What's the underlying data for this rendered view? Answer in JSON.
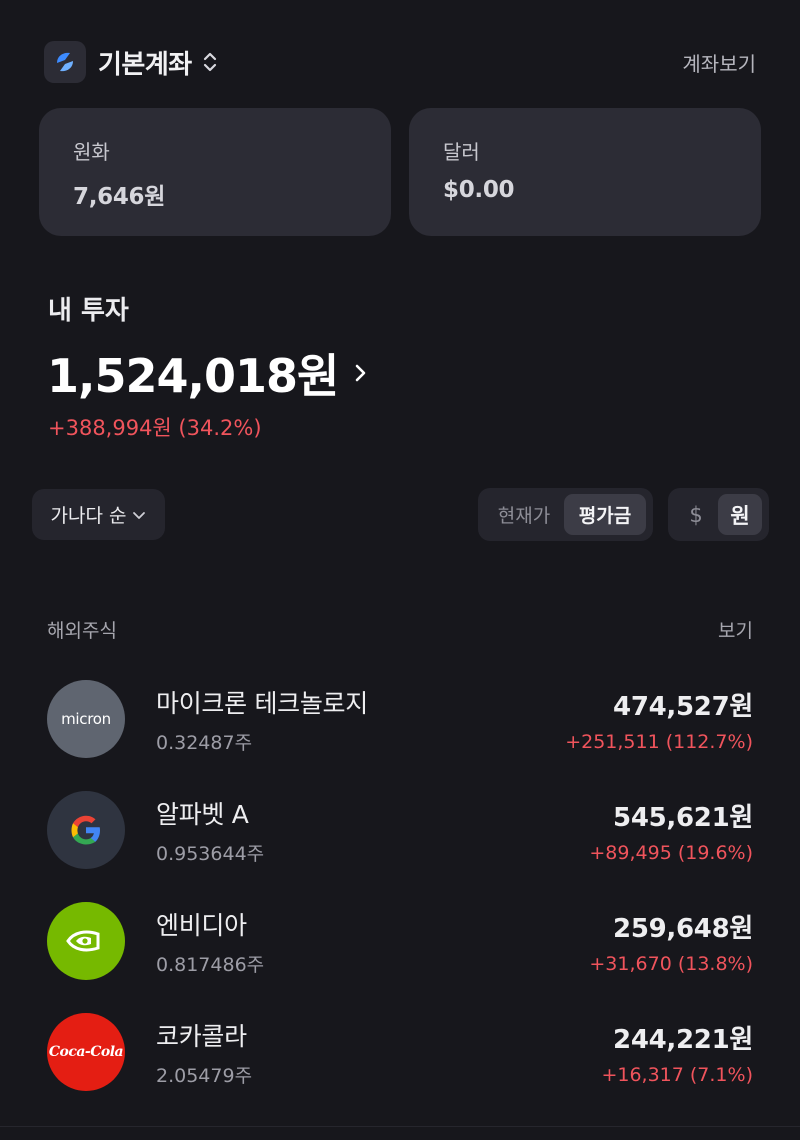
{
  "header": {
    "account_name": "기본계좌",
    "view_account": "계좌보기"
  },
  "balances": {
    "krw": {
      "label": "원화",
      "value": "7,646원"
    },
    "usd": {
      "label": "달러",
      "value": "$0.00"
    }
  },
  "investment": {
    "title": "내 투자",
    "total": "1,524,018원",
    "change": "+388,994원 (34.2%)"
  },
  "filters": {
    "sort_label": "가나다 순",
    "price_modes": [
      "현재가",
      "평가금"
    ],
    "price_mode_selected": "평가금",
    "currency_modes": [
      "$",
      "원"
    ],
    "currency_selected": "원"
  },
  "section": {
    "title": "해외주식",
    "view": "보기"
  },
  "stocks": [
    {
      "name": "마이크론 테크놀로지",
      "qty": "0.32487주",
      "value": "474,527원",
      "change": "+251,511 (112.7%)",
      "logo": "micron-logo"
    },
    {
      "name": "알파벳 A",
      "qty": "0.953644주",
      "value": "545,621원",
      "change": "+89,495 (19.6%)",
      "logo": "google-logo"
    },
    {
      "name": "엔비디아",
      "qty": "0.817486주",
      "value": "259,648원",
      "change": "+31,670 (13.8%)",
      "logo": "nvidia-logo"
    },
    {
      "name": "코카콜라",
      "qty": "2.05479주",
      "value": "244,221원",
      "change": "+16,317 (7.1%)",
      "logo": "coca-cola-logo"
    }
  ],
  "logo_text": {
    "micron": "micron",
    "coke": "Coca-Cola"
  },
  "colors": {
    "background": "#17171c",
    "card": "#2c2c35",
    "positive": "#f0545c",
    "accent_blue": "#3d8bff"
  }
}
